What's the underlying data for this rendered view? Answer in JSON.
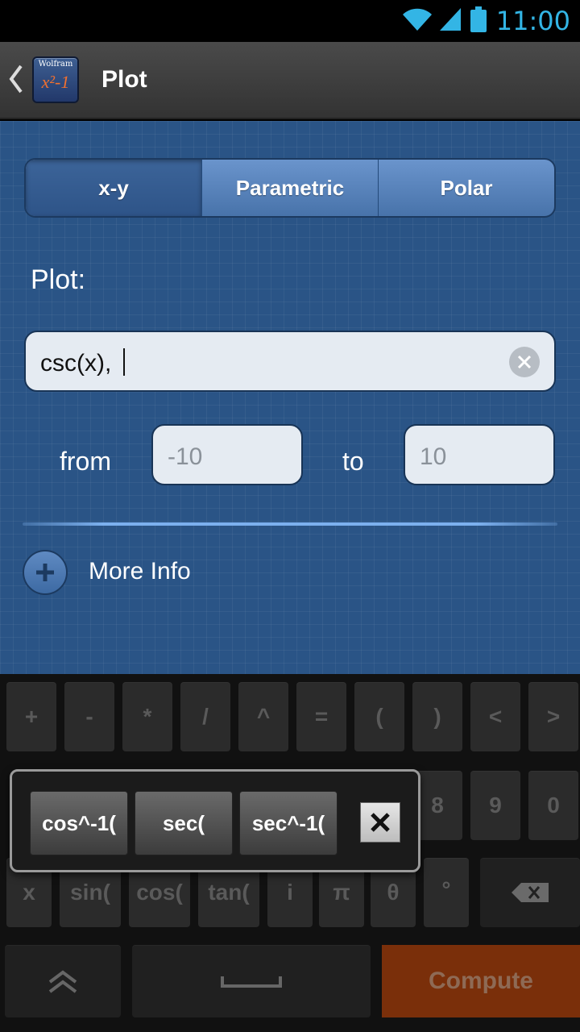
{
  "status_bar": {
    "time": "11:00",
    "icons": [
      "wifi-icon",
      "signal-icon",
      "battery-icon"
    ]
  },
  "action_bar": {
    "title": "Plot",
    "logo_top": "Wolfram",
    "logo_formula": "x²-1"
  },
  "tabs": [
    {
      "label": "x-y",
      "active": true
    },
    {
      "label": "Parametric",
      "active": false
    },
    {
      "label": "Polar",
      "active": false
    }
  ],
  "form": {
    "plot_label": "Plot:",
    "expression_value": "csc(x), ",
    "from_label": "from",
    "from_placeholder": "-10",
    "to_label": "to",
    "to_placeholder": "10",
    "more_info_label": "More Info"
  },
  "keyboard": {
    "row1": [
      "+",
      "-",
      "*",
      "/",
      "^",
      "=",
      "(",
      ")",
      "<",
      ">"
    ],
    "row2_visible": [
      "8",
      "9",
      "0"
    ],
    "row3": [
      "x",
      "sin(",
      "cos(",
      "tan(",
      "i",
      "π",
      "θ",
      "°"
    ],
    "compute_label": "Compute"
  },
  "popup": {
    "options": [
      "cos^-1(",
      "sec(",
      "sec^-1("
    ]
  },
  "colors": {
    "content_bg": "#2a5486",
    "status_accent": "#33b5e5",
    "compute_bg": "#7a2f0a"
  }
}
